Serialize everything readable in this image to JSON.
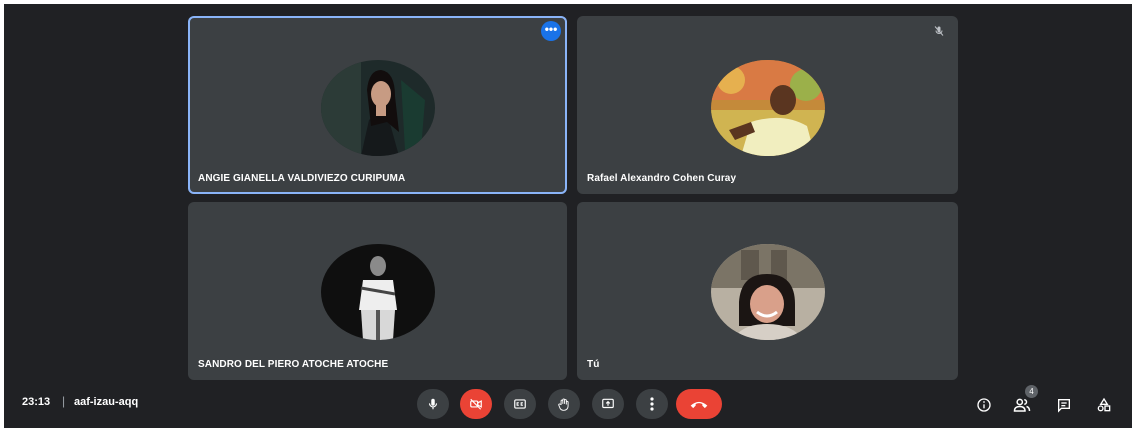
{
  "participants": [
    {
      "name": "ANGIE GIANELLA VALDIVIEZO CURIPUMA"
    },
    {
      "name": "Rafael Alexandro Cohen Curay"
    },
    {
      "name": "SANDRO DEL PIERO ATOCHE ATOCHE"
    },
    {
      "name": "Tú"
    }
  ],
  "tile_menu_glyph": "•••",
  "meeting": {
    "time": "23:13",
    "separator": "|",
    "code": "aaf-izau-aqq"
  },
  "people_count": "4",
  "colors": {
    "accent": "#1a73e8",
    "highlight": "#8ab4f8",
    "danger": "#ea4335",
    "tile": "#3c4043",
    "background": "#202124"
  },
  "controls": [
    "mic-icon",
    "camera-off-icon",
    "captions-icon",
    "raise-hand-icon",
    "present-icon",
    "more-vert-icon",
    "end-call-icon"
  ],
  "side_actions": [
    "info-icon",
    "people-icon",
    "chat-icon",
    "activities-icon"
  ]
}
